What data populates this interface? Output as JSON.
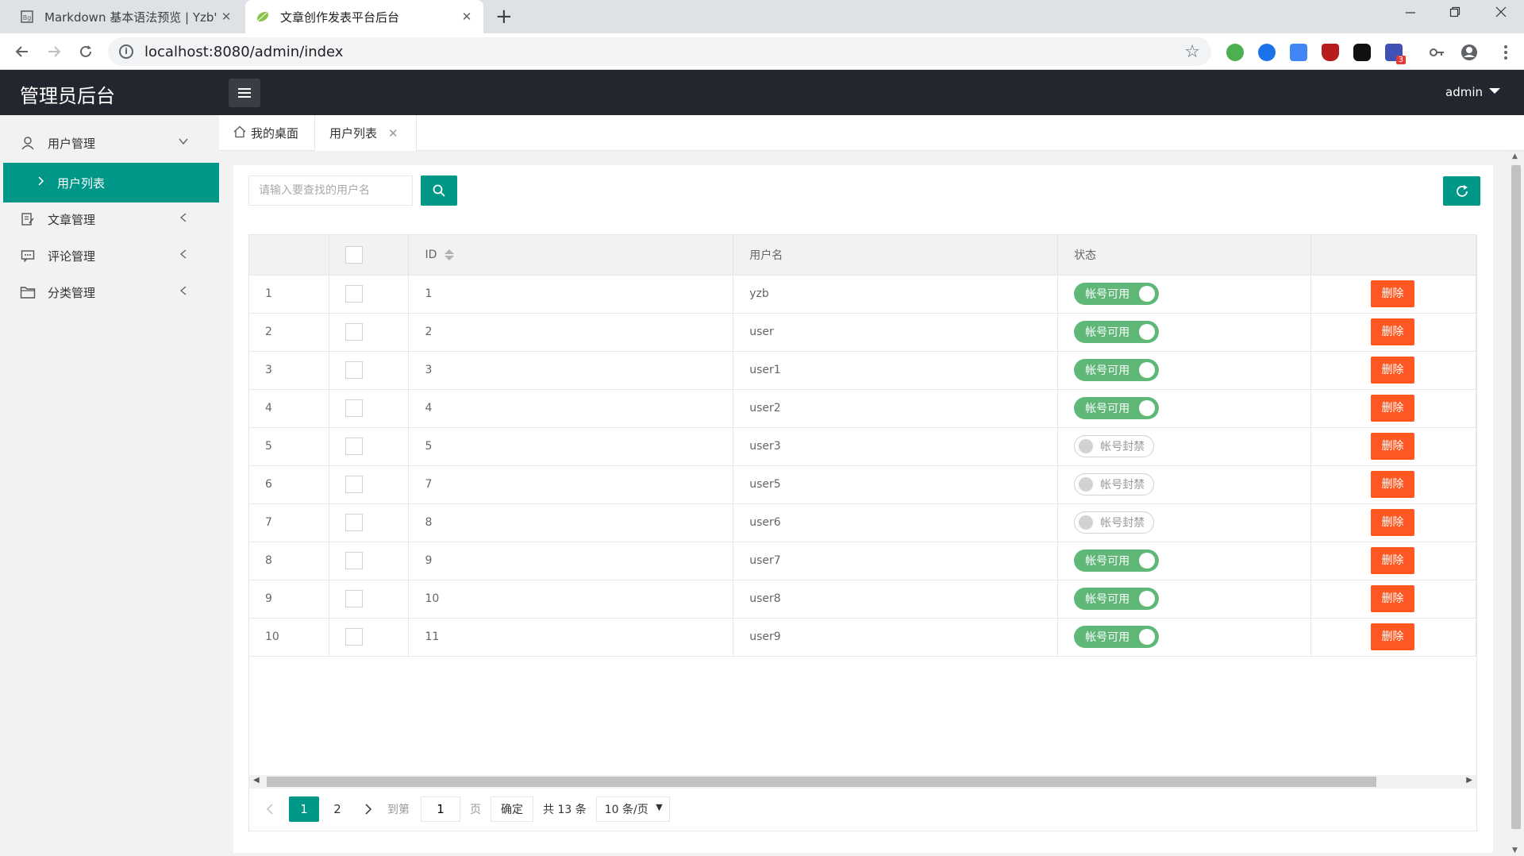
{
  "browser": {
    "tabs": [
      {
        "title": "Markdown 基本语法预览 | Yzb'",
        "close": "✕"
      },
      {
        "title": "文章创作发表平台后台",
        "close": "✕"
      }
    ],
    "new_tab": "+",
    "url": "localhost:8080/admin/index",
    "ext_badge": "3"
  },
  "header": {
    "logo": "管理员后台",
    "user": "admin"
  },
  "sidebar": {
    "items": [
      {
        "label": "用户管理",
        "icon": "user-icon"
      },
      {
        "label": "文章管理",
        "icon": "article-icon"
      },
      {
        "label": "评论管理",
        "icon": "comment-icon"
      },
      {
        "label": "分类管理",
        "icon": "folder-icon"
      }
    ],
    "sub_item": "用户列表"
  },
  "page_tabs": [
    {
      "label": "我的桌面"
    },
    {
      "label": "用户列表"
    }
  ],
  "search": {
    "placeholder": "请输入要查找的用户名"
  },
  "table": {
    "headers": [
      "",
      "",
      "ID",
      "用户名",
      "状态",
      ""
    ],
    "on_label": "帐号可用",
    "off_label": "帐号封禁",
    "delete_label": "删除",
    "rows": [
      {
        "no": "1",
        "id": "1",
        "name": "yzb",
        "enabled": true
      },
      {
        "no": "2",
        "id": "2",
        "name": "user",
        "enabled": true
      },
      {
        "no": "3",
        "id": "3",
        "name": "user1",
        "enabled": true
      },
      {
        "no": "4",
        "id": "4",
        "name": "user2",
        "enabled": true
      },
      {
        "no": "5",
        "id": "5",
        "name": "user3",
        "enabled": false
      },
      {
        "no": "6",
        "id": "7",
        "name": "user5",
        "enabled": false
      },
      {
        "no": "7",
        "id": "8",
        "name": "user6",
        "enabled": false
      },
      {
        "no": "8",
        "id": "9",
        "name": "user7",
        "enabled": true
      },
      {
        "no": "9",
        "id": "10",
        "name": "user8",
        "enabled": true
      },
      {
        "no": "10",
        "id": "11",
        "name": "user9",
        "enabled": true
      }
    ]
  },
  "pager": {
    "pages": [
      "1",
      "2"
    ],
    "goto_label": "到第",
    "goto_value": "1",
    "page_unit": "页",
    "confirm": "确定",
    "total": "共 13 条",
    "per_page": "10 条/页"
  },
  "colors": {
    "accent": "#009688",
    "header": "#23262e",
    "switch_on": "#5fb878",
    "danger": "#ff5722"
  }
}
